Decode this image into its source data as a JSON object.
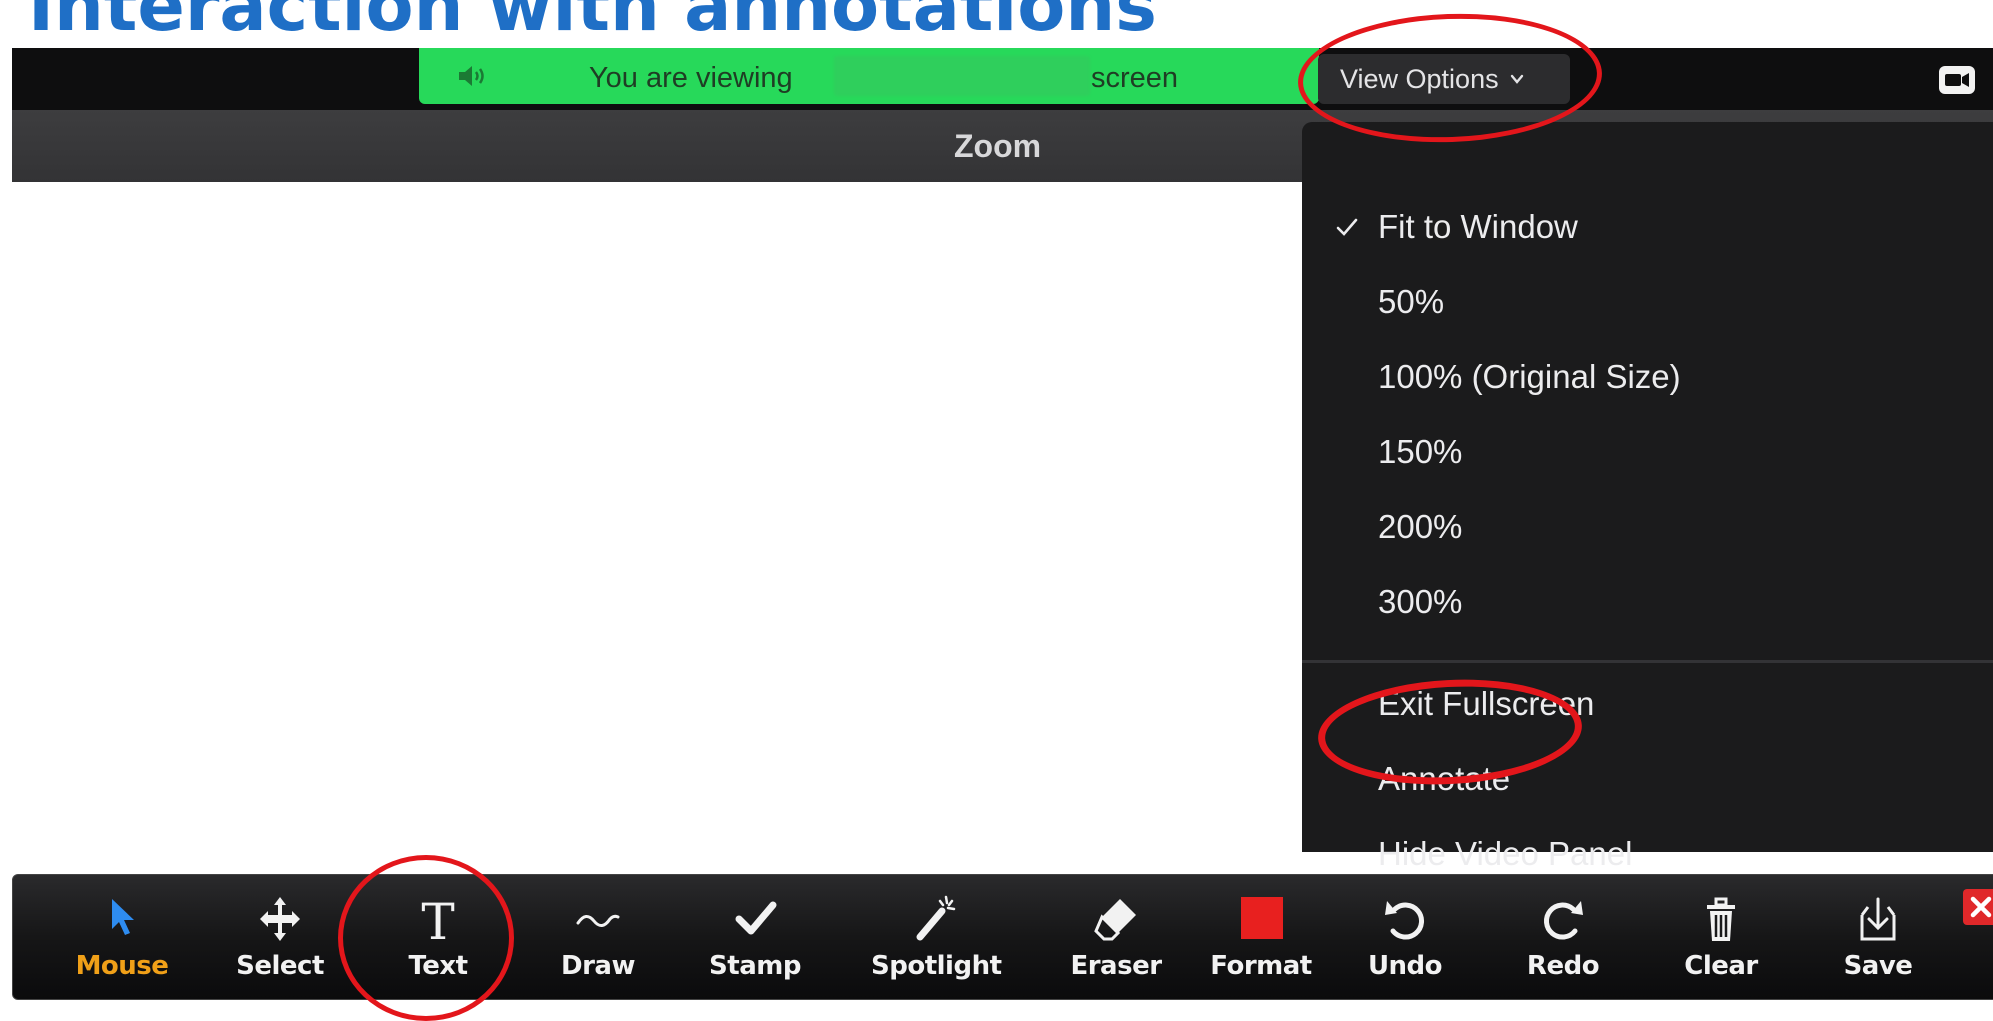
{
  "slide": {
    "title": "Interaction with annotations"
  },
  "banner": {
    "text_before": "You are viewing",
    "text_after": "screen"
  },
  "view_options": {
    "label": "View Options"
  },
  "window": {
    "title": "Zoom"
  },
  "menu": {
    "items": [
      {
        "label": "Fit to Window",
        "checked": true
      },
      {
        "label": "50%"
      },
      {
        "label": "100% (Original Size)"
      },
      {
        "label": "150%"
      },
      {
        "label": "200%"
      },
      {
        "label": "300%"
      },
      {
        "label": "Exit Fullscreen"
      },
      {
        "label": "Annotate"
      },
      {
        "label": "Hide Video Panel"
      }
    ]
  },
  "toolbar": {
    "tools": [
      {
        "label": "Mouse",
        "icon": "cursor-arrow-icon",
        "active": true
      },
      {
        "label": "Select",
        "icon": "move-arrows-icon"
      },
      {
        "label": "Text",
        "icon": "text-t-icon"
      },
      {
        "label": "Draw",
        "icon": "squiggle-icon"
      },
      {
        "label": "Stamp",
        "icon": "checkmark-icon"
      },
      {
        "label": "Spotlight",
        "icon": "magic-wand-icon"
      },
      {
        "label": "Eraser",
        "icon": "eraser-icon"
      },
      {
        "label": "Format",
        "icon": "color-swatch-icon"
      },
      {
        "label": "Undo",
        "icon": "undo-icon"
      },
      {
        "label": "Redo",
        "icon": "redo-icon"
      },
      {
        "label": "Clear",
        "icon": "trash-icon"
      },
      {
        "label": "Save",
        "icon": "save-download-icon"
      }
    ]
  },
  "colors": {
    "banner_green": "#27d95a",
    "title_blue": "#1f6fc6",
    "active_orange": "#f0a018",
    "highlight_red": "#e3161b",
    "format_swatch": "#e8201f"
  }
}
